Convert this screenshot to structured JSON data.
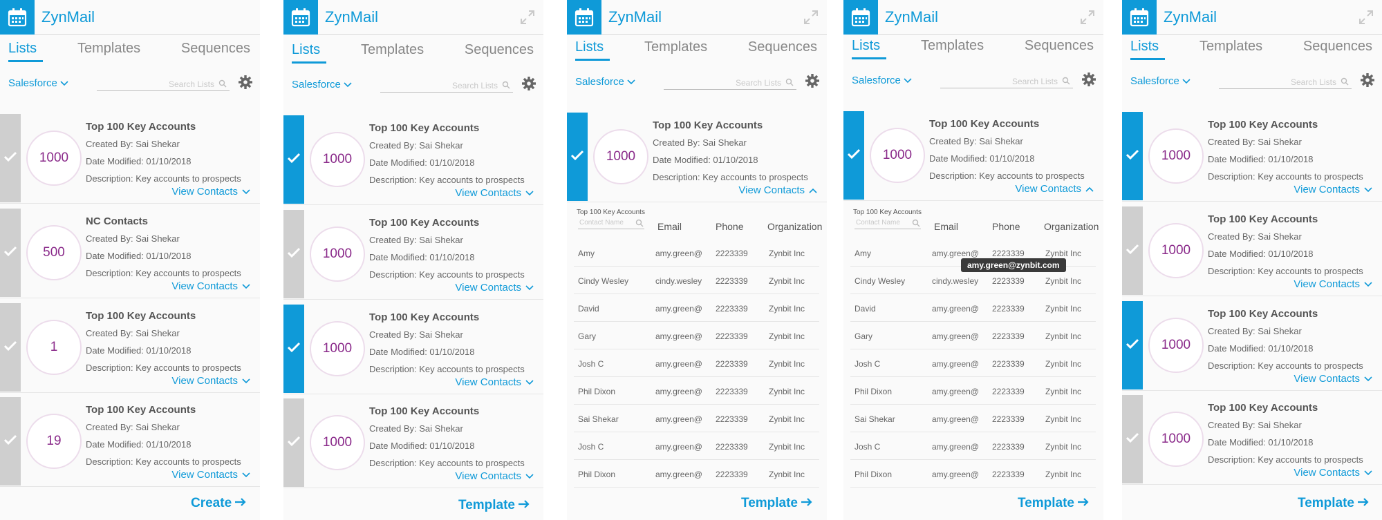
{
  "colors": {
    "accent": "#0f9ad8",
    "count": "#8a2a8a",
    "unselected": "#cfcfcf"
  },
  "app": {
    "title": "ZynMail"
  },
  "tabs": [
    "Lists",
    "Templates",
    "Sequences"
  ],
  "filter": {
    "source": "Salesforce",
    "search_placeholder": "Search Lists"
  },
  "card_text": {
    "created_by": "Created By: Sai Shekar",
    "date_modified": "Date Modified: 01/10/2018",
    "description": "Description: Key accounts to prospects",
    "view_contacts": "View Contacts"
  },
  "panels": [
    {
      "footer": "Create",
      "cards": [
        {
          "title": "Top 100 Key Accounts",
          "count": "1000",
          "selected": false
        },
        {
          "title": "NC Contacts",
          "count": "500",
          "selected": false
        },
        {
          "title": "Top 100 Key Accounts",
          "count": "1",
          "selected": false
        },
        {
          "title": "Top 100 Key Accounts",
          "count": "19",
          "selected": false
        }
      ]
    },
    {
      "footer": "Template",
      "cards": [
        {
          "title": "Top 100 Key Accounts",
          "count": "1000",
          "selected": true
        },
        {
          "title": "Top 100 Key Accounts",
          "count": "1000",
          "selected": false
        },
        {
          "title": "Top 100 Key Accounts",
          "count": "1000",
          "selected": true
        },
        {
          "title": "Top 100 Key Accounts",
          "count": "1000",
          "selected": false
        }
      ]
    },
    {
      "footer": "Template",
      "cards": [
        {
          "title": "Top 100 Key Accounts",
          "count": "1000",
          "selected": true
        }
      ]
    },
    {
      "footer": "Template",
      "tooltip": "amy.green@zynbit.com",
      "cards": [
        {
          "title": "Top 100 Key Accounts",
          "count": "1000",
          "selected": true
        }
      ]
    },
    {
      "footer": "Template",
      "cards": [
        {
          "title": "Top 100 Key Accounts",
          "count": "1000",
          "selected": true
        },
        {
          "title": "Top 100 Key Accounts",
          "count": "1000",
          "selected": false
        },
        {
          "title": "Top 100 Key Accounts",
          "count": "1000",
          "selected": true
        },
        {
          "title": "Top 100 Key Accounts",
          "count": "1000",
          "selected": false
        }
      ]
    }
  ],
  "contacts_table": {
    "caption": "Top 100 Key Accounts",
    "filter_placeholder": "Contact Name",
    "columns": [
      "Email",
      "Phone",
      "Organization"
    ],
    "rows": [
      [
        "Amy",
        "amy.green@",
        "2223339",
        "Zynbit Inc"
      ],
      [
        "Cindy Wesley",
        "cindy.wesley",
        "2223339",
        "Zynbit Inc"
      ],
      [
        "David",
        "amy.green@",
        "2223339",
        "Zynbit Inc"
      ],
      [
        "Gary",
        "amy.green@",
        "2223339",
        "Zynbit Inc"
      ],
      [
        "Josh C",
        "amy.green@",
        "2223339",
        "Zynbit Inc"
      ],
      [
        "Phil Dixon",
        "amy.green@",
        "2223339",
        "Zynbit Inc"
      ],
      [
        "Sai Shekar",
        "amy.green@",
        "2223339",
        "Zynbit Inc"
      ],
      [
        "Josh C",
        "amy.green@",
        "2223339",
        "Zynbit Inc"
      ],
      [
        "Phil Dixon",
        "amy.green@",
        "2223339",
        "Zynbit Inc"
      ]
    ]
  }
}
